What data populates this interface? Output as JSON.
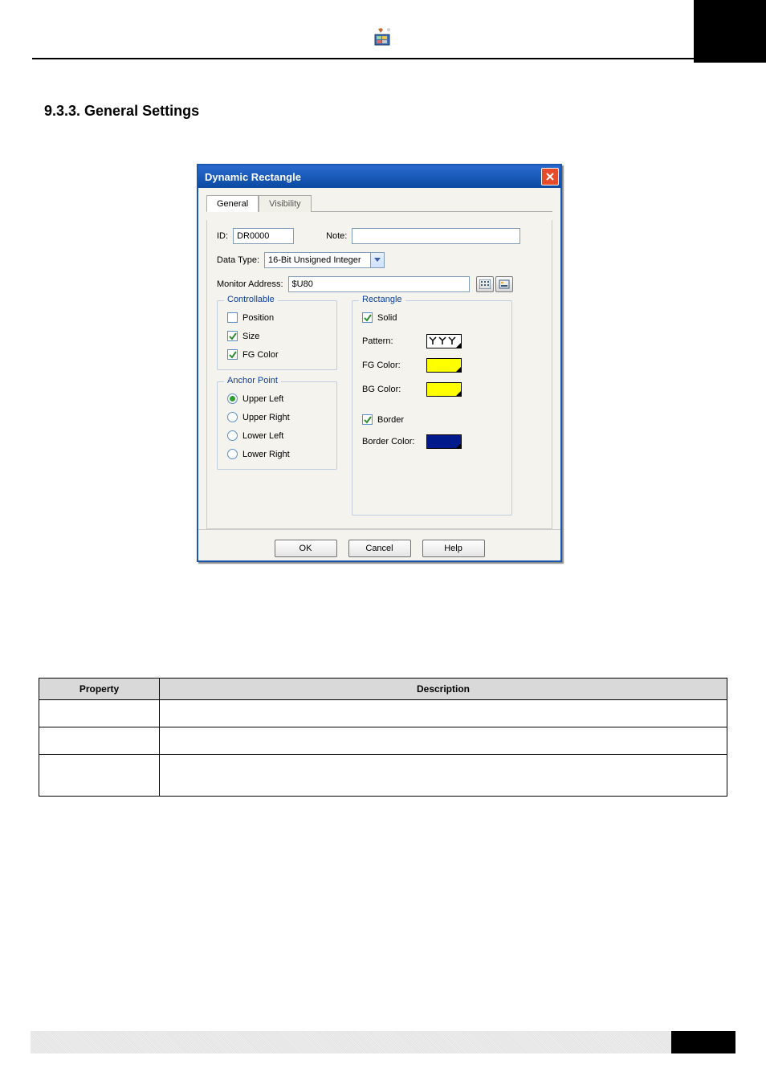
{
  "heading": "9.3.3. General Settings",
  "dialog": {
    "title": "Dynamic Rectangle",
    "tabs": [
      "General",
      "Visibility"
    ],
    "active_tab": 0,
    "id_label": "ID:",
    "id_value": "DR0000",
    "note_label": "Note:",
    "note_value": "",
    "data_type_label": "Data Type:",
    "data_type_value": "16-Bit Unsigned Integer",
    "monitor_label": "Monitor Address:",
    "monitor_value": "$U80",
    "controllable": {
      "title": "Controllable",
      "position": {
        "label": "Position",
        "checked": false
      },
      "size": {
        "label": "Size",
        "checked": true
      },
      "fg_color": {
        "label": "FG Color",
        "checked": true
      }
    },
    "anchor": {
      "title": "Anchor Point",
      "options": [
        "Upper Left",
        "Upper Right",
        "Lower Left",
        "Lower Right"
      ],
      "selected": 0
    },
    "rectangle": {
      "title": "Rectangle",
      "solid": {
        "label": "Solid",
        "checked": true
      },
      "pattern_label": "Pattern:",
      "fg_label": "FG Color:",
      "fg_color": "#ffff00",
      "bg_label": "BG Color:",
      "bg_color": "#ffff00",
      "border": {
        "label": "Border",
        "checked": true
      },
      "border_color_label": "Border Color:",
      "border_color": "#001a8c"
    },
    "buttons": {
      "ok": "OK",
      "cancel": "Cancel",
      "help": "Help"
    }
  },
  "table": {
    "headers": [
      "Property",
      "Description"
    ]
  }
}
